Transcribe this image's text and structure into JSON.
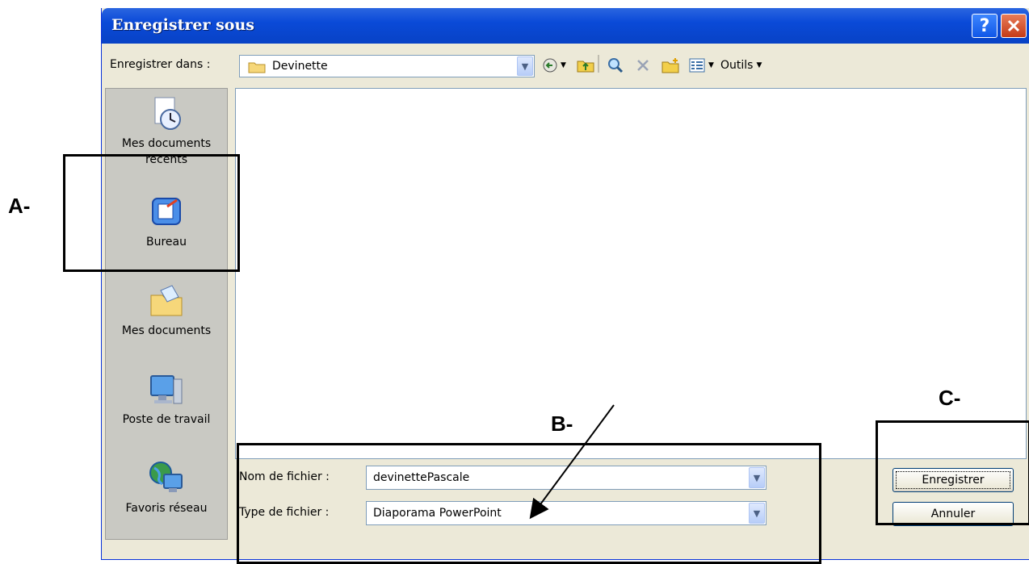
{
  "dialog": {
    "title": "Enregistrer sous",
    "save_in_label": "Enregistrer dans :",
    "save_in_value": "Devinette",
    "tools_label": "Outils"
  },
  "places": [
    {
      "line1": "Mes documents",
      "line2": "recents",
      "icon": "recent-documents-icon"
    },
    {
      "line1": "Bureau",
      "line2": "",
      "icon": "desktop-icon"
    },
    {
      "line1": "Mes documents",
      "line2": "",
      "icon": "my-documents-icon"
    },
    {
      "line1": "Poste de travail",
      "line2": "",
      "icon": "my-computer-icon"
    },
    {
      "line1": "Favoris réseau",
      "line2": "",
      "icon": "network-places-icon"
    }
  ],
  "fields": {
    "filename_label": "Nom de fichier :",
    "filename_value": "devinettePascale",
    "filetype_label": "Type de fichier :",
    "filetype_value": "Diaporama PowerPoint"
  },
  "buttons": {
    "save": "Enregistrer",
    "cancel": "Annuler"
  },
  "annotations": {
    "a": "A-",
    "b": "B-",
    "c": "C-"
  }
}
